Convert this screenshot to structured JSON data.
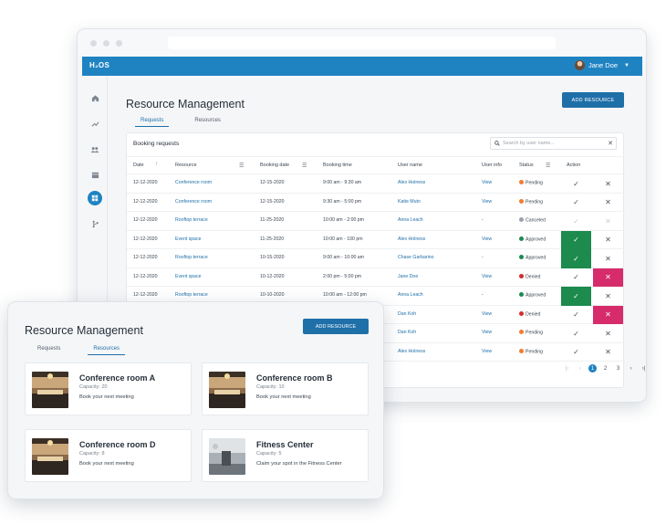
{
  "app": {
    "logo": "H₂OS",
    "user_name": "Jane Doe"
  },
  "nav_icons": [
    "home-icon",
    "chart-icon",
    "people-icon",
    "calendar-icon",
    "grid-icon",
    "branch-icon"
  ],
  "booking_page": {
    "title": "Resource Management",
    "add_button": "ADD RESOURCE",
    "tabs": [
      "Requests",
      "Resources"
    ],
    "active_tab": "Requests",
    "card_title": "Booking requests",
    "search_placeholder": "Search by user name...",
    "columns": [
      "Date",
      "Resource",
      "Booking date",
      "Booking time",
      "User name",
      "User info",
      "Status",
      "Action"
    ],
    "rows": [
      {
        "date": "12-12-2020",
        "resource": "Conference room",
        "booking_date": "12-15-2020",
        "time": "9:00 am - 9:30 am",
        "user": "Alex Holness",
        "info": "View",
        "status": "Pending",
        "status_color": "#f07d2e",
        "approve": "✓",
        "reject": "✕",
        "highlight": ""
      },
      {
        "date": "12-12-2020",
        "resource": "Conference room",
        "booking_date": "12-15-2020",
        "time": "9:30 am - 5:00 pm",
        "user": "Katie Muto",
        "info": "View",
        "status": "Pending",
        "status_color": "#f07d2e",
        "approve": "✓",
        "reject": "✕",
        "highlight": ""
      },
      {
        "date": "12-12-2020",
        "resource": "Rooftop terrace",
        "booking_date": "11-25-2020",
        "time": "10:00 am - 2:00 pm",
        "user": "Anna Leach",
        "info": "-",
        "status": "Canceled",
        "status_color": "#9aa3ad",
        "approve": "✓",
        "reject": "✕",
        "highlight": "faint"
      },
      {
        "date": "12-12-2020",
        "resource": "Event space",
        "booking_date": "11-25-2020",
        "time": "10:00 am - 100 pm",
        "user": "Alex Holness",
        "info": "View",
        "status": "Approved",
        "status_color": "#1d8a4e",
        "approve": "✓",
        "reject": "✕",
        "highlight": "ok"
      },
      {
        "date": "12-12-2020",
        "resource": "Rooftop terrace",
        "booking_date": "10-15-2020",
        "time": "9:00 am - 10:00 am",
        "user": "Chase Garbarino",
        "info": "-",
        "status": "Approved",
        "status_color": "#1d8a4e",
        "approve": "✓",
        "reject": "✕",
        "highlight": "ok"
      },
      {
        "date": "12-12-2020",
        "resource": "Event space",
        "booking_date": "10-12-2020",
        "time": "2:00 pm - 5:00 pm",
        "user": "Jane Doe",
        "info": "View",
        "status": "Denied",
        "status_color": "#d62c2c",
        "approve": "✓",
        "reject": "✕",
        "highlight": "no"
      },
      {
        "date": "12-12-2020",
        "resource": "Rooftop terrace",
        "booking_date": "10-10-2020",
        "time": "10:00 am - 12:00 pm",
        "user": "Anna Leach",
        "info": "-",
        "status": "Approved",
        "status_color": "#1d8a4e",
        "approve": "✓",
        "reject": "✕",
        "highlight": "ok"
      },
      {
        "date": "",
        "resource": "",
        "booking_date": "",
        "time": "",
        "user": "Dan Koh",
        "info": "View",
        "status": "Denied",
        "status_color": "#d62c2c",
        "approve": "✓",
        "reject": "✕",
        "highlight": "no"
      },
      {
        "date": "",
        "resource": "",
        "booking_date": "",
        "time": "",
        "user": "Dan Koh",
        "info": "View",
        "status": "Pending",
        "status_color": "#f07d2e",
        "approve": "✓",
        "reject": "✕",
        "highlight": ""
      },
      {
        "date": "",
        "resource": "",
        "booking_date": "",
        "time": "",
        "user": "Alex Holness",
        "info": "View",
        "status": "Pending",
        "status_color": "#f07d2e",
        "approve": "✓",
        "reject": "✕",
        "highlight": ""
      }
    ],
    "pagination": {
      "first": "|‹",
      "prev": "‹",
      "pages": [
        "1",
        "2",
        "3"
      ],
      "current": "1",
      "next": "›",
      "last": "›|"
    }
  },
  "resources_page": {
    "title": "Resource Management",
    "add_button": "ADD RESOURCE",
    "tabs": [
      "Requests",
      "Resources"
    ],
    "active_tab": "Resources",
    "cards": [
      {
        "name": "Conference room A",
        "capacity": "Capacity: 20",
        "desc": "Book your next meeting",
        "img": "meeting-room-photo"
      },
      {
        "name": "Conference room B",
        "capacity": "Capacity: 10",
        "desc": "Book your next meeting",
        "img": "meeting-room-photo"
      },
      {
        "name": "Conference room D",
        "capacity": "Capacity: 8",
        "desc": "Book your next meeting",
        "img": "meeting-room-photo"
      },
      {
        "name": "Fitness Center",
        "capacity": "Capacity: 5",
        "desc": "Claim your spot in the Fitness Center",
        "img": "gym-photo"
      }
    ]
  }
}
